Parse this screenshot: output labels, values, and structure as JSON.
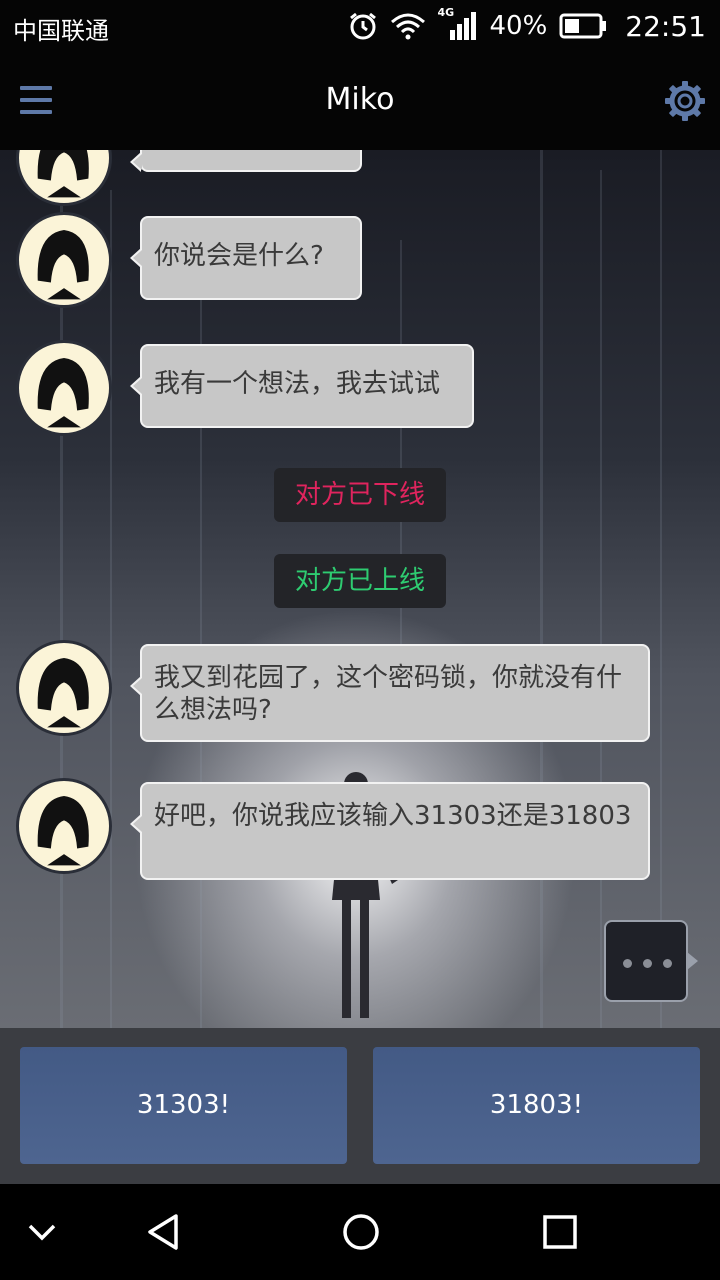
{
  "status_bar": {
    "carrier": "中国联通",
    "network": "4G",
    "battery": "40%",
    "time": "22:51",
    "icons": [
      "alarm-icon",
      "wifi-icon",
      "signal-icon",
      "battery-icon"
    ]
  },
  "header": {
    "title": "Miko",
    "menu_icon": "menu-icon",
    "settings_icon": "gear-icon",
    "accent_color": "#5e79a8"
  },
  "messages": [
    {
      "type": "incoming",
      "text": "你说会是什么?"
    },
    {
      "type": "incoming",
      "text": "我有一个想法，我去试试"
    },
    {
      "type": "system",
      "text": "对方已下线",
      "color": "#e0245e"
    },
    {
      "type": "system",
      "text": "对方已上线",
      "color": "#2ecc71"
    },
    {
      "type": "incoming",
      "text": "我又到花园了，这个密码锁，你就没有什么想法吗?"
    },
    {
      "type": "incoming",
      "text": "好吧，你说我应该输入31303还是31803"
    }
  ],
  "typing_indicator": "•••",
  "options": [
    {
      "label": "31303!"
    },
    {
      "label": "31803!"
    }
  ],
  "nav_bar": {
    "icons": [
      "chevron-down-icon",
      "back-icon",
      "home-icon",
      "recents-icon"
    ]
  }
}
